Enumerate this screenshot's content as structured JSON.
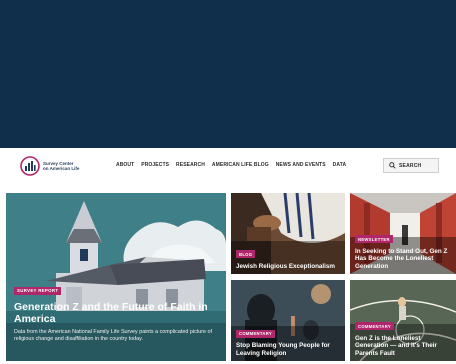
{
  "site": {
    "logo_text_line1": "Survey Center",
    "logo_text_line2": "on American Life",
    "colors": {
      "banner": "#0f2f4a",
      "tag": "#b0266a",
      "navy": "#1f3a5a"
    }
  },
  "nav": {
    "items": [
      {
        "label": "ABOUT"
      },
      {
        "label": "PROJECTS"
      },
      {
        "label": "RESEARCH"
      },
      {
        "label": "AMERICAN LIFE BLOG"
      },
      {
        "label": "NEWS AND EVENTS"
      },
      {
        "label": "DATA"
      }
    ],
    "search_label": "SEARCH",
    "search_icon": "search-icon"
  },
  "hero": {
    "tag": "SURVEY REPORT",
    "title": "Generation Z and the Future of Faith in America",
    "description": "Data from the American National Family Life Survey paints a complicated picture of religious change and disaffiliation in the country today."
  },
  "cards": [
    {
      "tag": "BLOG",
      "title": "Jewish Religious Exceptionalism"
    },
    {
      "tag": "NEWSLETTER",
      "title": "In Seeking to Stand Out, Gen Z Has Become the Loneliest Generation"
    },
    {
      "tag": "COMMENTARY",
      "title": "Stop Blaming Young People for Leaving Religion"
    },
    {
      "tag": "COMMENTARY",
      "title": "Gen Z is the Loneliest Generation — and It's Their Parents Fault"
    }
  ]
}
